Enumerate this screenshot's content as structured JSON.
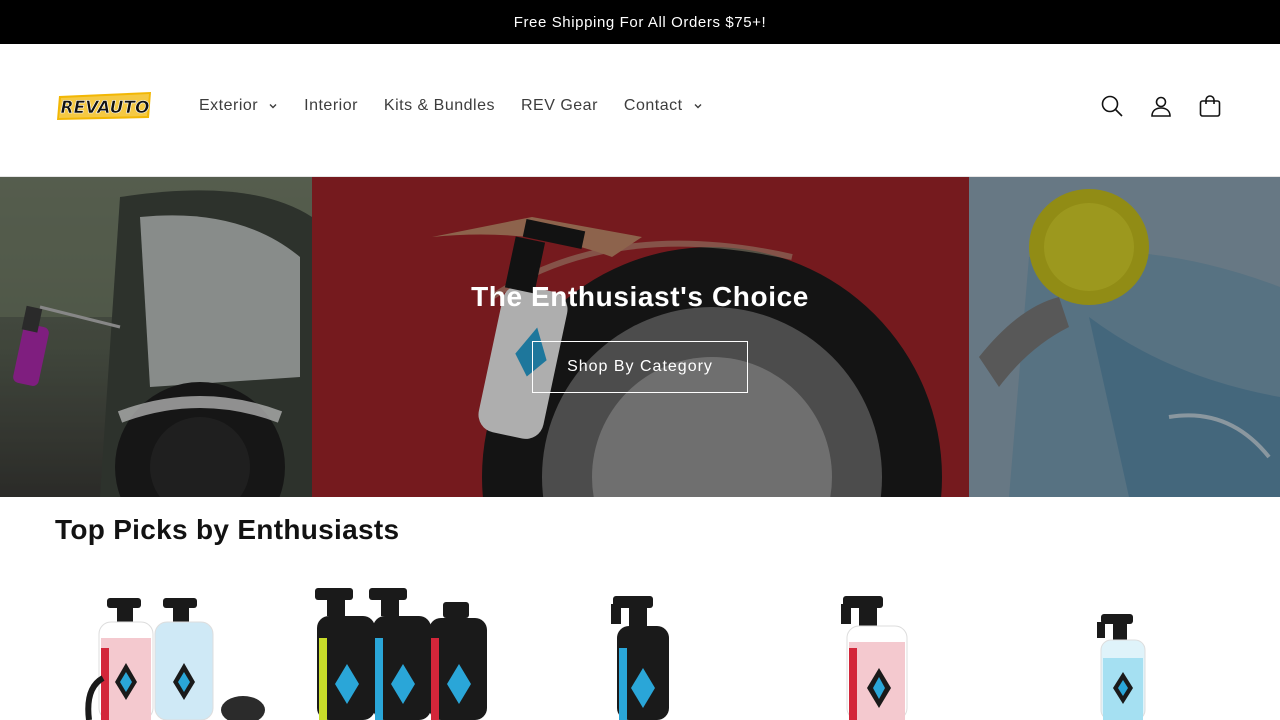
{
  "announcement": {
    "text": "Free Shipping For All Orders $75+!"
  },
  "header": {
    "logo_text": "REVAUTO",
    "nav": [
      {
        "label": "Exterior",
        "has_dropdown": true
      },
      {
        "label": "Interior",
        "has_dropdown": false
      },
      {
        "label": "Kits & Bundles",
        "has_dropdown": false
      },
      {
        "label": "REV Gear",
        "has_dropdown": false
      },
      {
        "label": "Contact",
        "has_dropdown": true
      }
    ],
    "icons": [
      "search-icon",
      "account-icon",
      "cart-icon"
    ]
  },
  "hero": {
    "title": "The Enthusiast's Choice",
    "button_label": "Shop By Category",
    "panels": [
      "snow-foam-wheel-photo",
      "spray-bottle-tire-photo",
      "wash-mitt-photo"
    ]
  },
  "section": {
    "title": "Top Picks by Enthusiasts",
    "products": [
      {
        "image": "two-spray-bottles-kit"
      },
      {
        "image": "three-bottle-bundle"
      },
      {
        "image": "single-spray-bottle-blue"
      },
      {
        "image": "single-spray-bottle-red"
      },
      {
        "image": "small-spray-bottle-cyan"
      }
    ]
  },
  "colors": {
    "announcement_bg": "#000000",
    "logo_yellow": "#f2b705",
    "bottle_black": "#1a1a1a",
    "label_blue": "#2aa6d8",
    "label_red": "#d3263a"
  }
}
